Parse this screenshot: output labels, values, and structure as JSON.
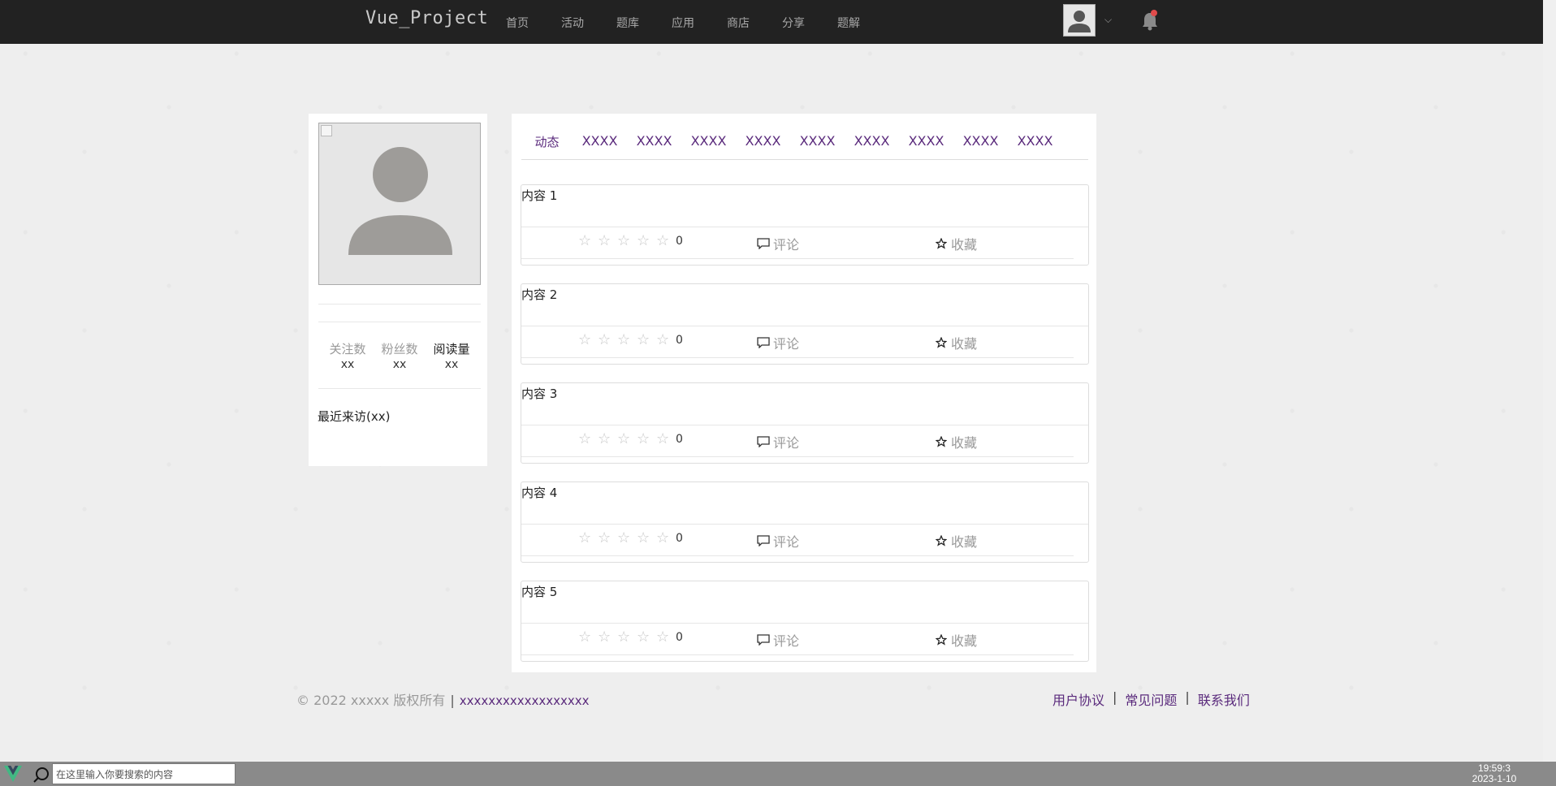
{
  "nav": {
    "brand": "Vue_Project",
    "links": [
      "首页",
      "活动",
      "题库",
      "应用",
      "商店",
      "分享",
      "题解"
    ]
  },
  "profile": {
    "stats": [
      {
        "label": "关注数",
        "value": "xx"
      },
      {
        "label": "粉丝数",
        "value": "xx"
      },
      {
        "label": "阅读量",
        "value": "xx"
      }
    ],
    "recent_visits": "最近来访(xx)"
  },
  "tabs": [
    "动态",
    "XXXX",
    "XXXX",
    "XXXX",
    "XXXX",
    "XXXX",
    "XXXX",
    "XXXX",
    "XXXX",
    "XXXX"
  ],
  "posts": [
    {
      "title": "内容 1",
      "rating": "0",
      "comment_label": "评论",
      "fav_label": "收藏"
    },
    {
      "title": "内容 2",
      "rating": "0",
      "comment_label": "评论",
      "fav_label": "收藏"
    },
    {
      "title": "内容 3",
      "rating": "0",
      "comment_label": "评论",
      "fav_label": "收藏"
    },
    {
      "title": "内容 4",
      "rating": "0",
      "comment_label": "评论",
      "fav_label": "收藏"
    },
    {
      "title": "内容 5",
      "rating": "0",
      "comment_label": "评论",
      "fav_label": "收藏"
    }
  ],
  "footer": {
    "copyright": "© 2022 xxxxx 版权所有",
    "separator": "|",
    "site_link": "xxxxxxxxxxxxxxxxxx",
    "links": [
      "用户协议",
      "常见问题",
      "联系我们"
    ]
  },
  "taskbar": {
    "search_placeholder": "在这里输入你要搜索的内容",
    "time": "19:59:3",
    "date": "2023-1-10"
  },
  "colors": {
    "nav_bg": "#222222",
    "link_purple": "#5a2a7c",
    "notification_dot": "#e04b4b"
  }
}
